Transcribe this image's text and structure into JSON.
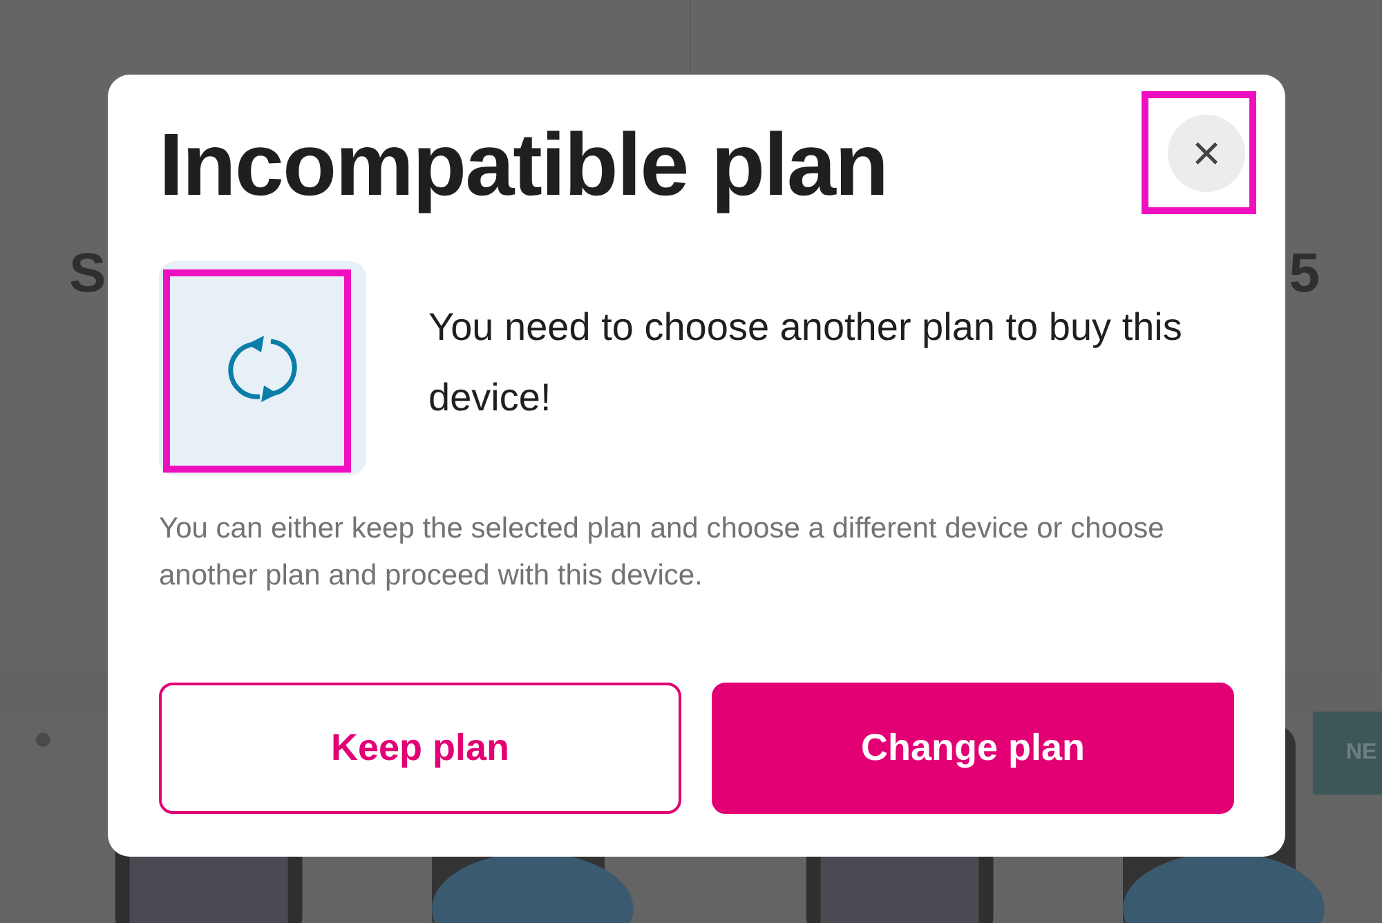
{
  "background": {
    "cards": [
      {
        "title": "S"
      },
      {
        "title": "5"
      }
    ],
    "badge": "NE"
  },
  "dialog": {
    "title": "Incompatible plan",
    "close_label": "×",
    "message": "You need to choose another plan to buy this device!",
    "description": "You can either keep the selected plan and choose a different device or choose another plan and proceed with this device.",
    "buttons": [
      {
        "label": "Keep plan",
        "kind": "secondary"
      },
      {
        "label": "Change plan",
        "kind": "primary"
      }
    ]
  }
}
